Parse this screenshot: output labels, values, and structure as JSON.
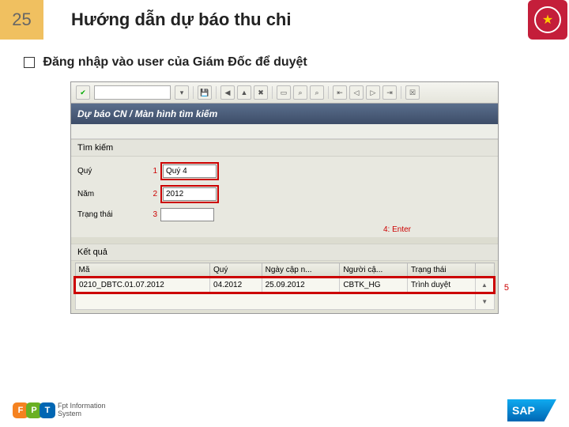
{
  "header": {
    "slide_number": "25",
    "title": "Hướng dẫn dự báo thu chi"
  },
  "instruction": "Đăng nhập vào user của Giám Đốc để duyệt",
  "sap": {
    "window_title": "Dự báo CN / Màn hình tìm kiếm",
    "search_section": "Tìm kiếm",
    "fields": {
      "quy": {
        "label": "Quý",
        "num": "1",
        "value": "Quý 4"
      },
      "nam": {
        "label": "Năm",
        "num": "2",
        "value": "2012"
      },
      "trangthai": {
        "label": "Trạng thái",
        "num": "3",
        "value": ""
      }
    },
    "enter_hint": "4: Enter",
    "result_section": "Kết quả",
    "columns": {
      "ma": "Mã",
      "quy": "Quý",
      "ngay": "Ngày cập n...",
      "nguoi": "Người cậ...",
      "trang": "Trạng thái"
    },
    "row": {
      "ma": "0210_DBTC.01.07.2012",
      "quy": "04.2012",
      "ngay": "25.09.2012",
      "nguoi": "CBTK_HG",
      "trang": "Trình duyệt"
    },
    "callout5": "5"
  },
  "footer": {
    "fpt_line1": "Fpt Information",
    "fpt_line2": "System",
    "sap": "SAP"
  }
}
